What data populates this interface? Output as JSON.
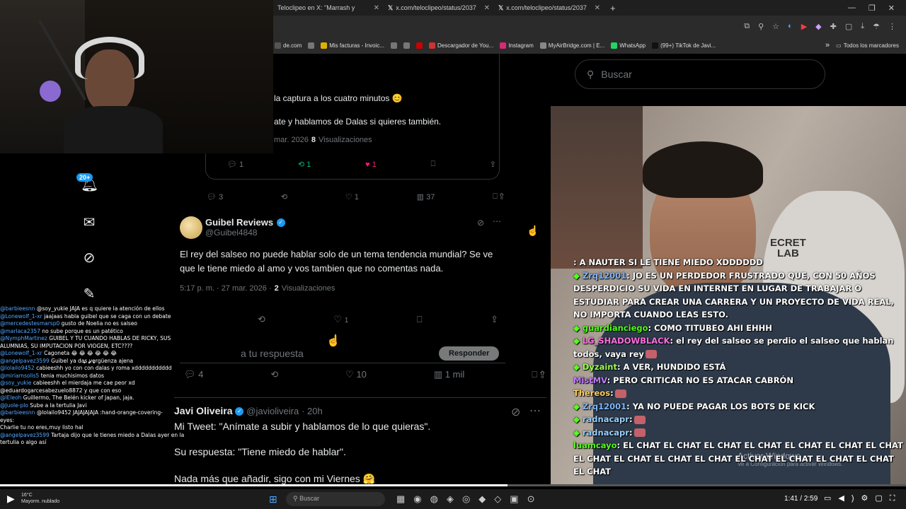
{
  "browser": {
    "tabs": [
      {
        "title": "Teloclipeo en X: \"Marrash y"
      },
      {
        "title": "x.com/teloclipeo/status/2037"
      },
      {
        "title": "x.com/teloclipeo/status/2037"
      }
    ],
    "new_tab": "+",
    "bookmarks": [
      {
        "label": "de.com",
        "color": "#555"
      },
      {
        "label": "",
        "color": "#777"
      },
      {
        "label": "Mis facturas - Invoic...",
        "color": "#e0b000"
      },
      {
        "label": "",
        "color": "#777"
      },
      {
        "label": "",
        "color": "#777"
      },
      {
        "label": "",
        "color": "#c00"
      },
      {
        "label": "Descargador de You...",
        "color": "#c33"
      },
      {
        "label": "Instagram",
        "color": "#d62976"
      },
      {
        "label": "MyAirBridge.com | E...",
        "color": "#888"
      },
      {
        "label": "WhatsApp",
        "color": "#25d366"
      },
      {
        "label": "(99+) TikTok de Javi...",
        "color": "#111"
      }
    ],
    "bookmarks_more": "»",
    "all_bookmarks": "Todos los marcadores"
  },
  "search": {
    "placeholder": "Buscar"
  },
  "nav_badge": "20+",
  "tweet_top": {
    "line1": "la captura a los cuatro minutos 😊",
    "line2": "ate y hablamos de Dalas si quieres también.",
    "meta_date": "mar. 2026",
    "meta_views_count": "8",
    "meta_views_label": "Visualizaciones",
    "reply_count": "1",
    "retweet_count": "1",
    "like_count": "1"
  },
  "tweet_parent_actions": {
    "reply": "3",
    "like": "1",
    "views": "37"
  },
  "tweet_guibel": {
    "name": "Guibel Reviews",
    "handle": "@Guibel4848",
    "text": "El rey del salseo no puede hablar solo de un tema tendencia mundial? Se ve que le tiene miedo al amo y vos tambien que no comentas nada.",
    "time": "5:17 p. m. · 27 mar. 2026 ·",
    "views_count": "2",
    "views_label": "Visualizaciones",
    "like_count": "1",
    "reply_placeholder": "a tu respuesta",
    "reply_button": "Responder"
  },
  "tweet_main_actions": {
    "reply": "4",
    "like": "10",
    "views": "1 mil"
  },
  "tweet_javi": {
    "name": "Javi Oliveira",
    "handle": "@javioliveira",
    "age": "· 20h",
    "line1": "Mi Tweet: \"Anímate a subir y hablamos de lo que quieras\".",
    "line2": "Su respuesta: \"Tiene miedo de hablar\".",
    "line3": "Nada más que añadir, sigo con mi Viernes 🤗"
  },
  "chat": [
    {
      "user": "",
      "color": "#ff4d4d",
      "text": ": A NAUTER SI LE TIENE MIEDO XDDDDDD",
      "diamond": false
    },
    {
      "user": "Zrq12001",
      "color": "#7fb8ff",
      "text": ": JO ES UN PERDEDOR FRUSTRADO QUE, CON 50 AÑOS DESPERDICIO SU VIDA EN INTERNET EN LUGAR DE TRABAJAR O ESTUDIAR PARA CREAR UNA CARRERA Y UN PROYECTO DE VIDA REAL, NO IMPORTA CUANDO LEAS ESTO.",
      "diamond": true
    },
    {
      "user": "guardianciego",
      "color": "#53fc18",
      "text": ": COMO TITUBEO AHI EHHH",
      "diamond": true
    },
    {
      "user": "LG_SHADOWBLACK",
      "color": "#ff6fe0",
      "text": ": el rey del salseo se perdio el salseo que hablan todos, vaya rey",
      "diamond": true,
      "emotes_end": 1
    },
    {
      "user": "Dyzaint",
      "color": "#9aff4d",
      "text": ": A VER, HUNDIDO ESTÁ",
      "diamond": true
    },
    {
      "user": "MistMV",
      "color": "#c27bff",
      "text": ": PERO CRITICAR NO ES ATACAR CABRÓN",
      "diamond": false
    },
    {
      "user": "Thereos",
      "color": "#ffcf5a",
      "text": ":",
      "diamond": false,
      "emotes_end": 1
    },
    {
      "user": "Zrq12001",
      "color": "#7fb8ff",
      "text": ": YA NO PUEDE PAGAR LOS BOTS DE KICK",
      "diamond": true
    },
    {
      "user": "radnacapr",
      "color": "#9ad0ff",
      "text": ":",
      "diamond": true,
      "emotes_end": 1
    },
    {
      "user": "radnacapr",
      "color": "#9ad0ff",
      "text": ":",
      "diamond": true,
      "emotes_end": 1
    },
    {
      "user": "luamcayo",
      "color": "#53fc18",
      "text": ": EL CHAT EL CHAT EL CHAT EL CHAT EL CHAT EL CHAT EL CHAT EL CHAT EL CHAT EL CHAT EL CHAT EL CHAT EL CHAT EL CHAT EL CHAT EL CHAT",
      "diamond": false
    }
  ],
  "minichat": [
    {
      "user": "@barbieesnn",
      "text": "@soy_yukie JAJA es q quiere la atención de ellos"
    },
    {
      "user": "@Lonewolf_1-xr",
      "text": "jaajaas habla guibel que se caga con un debate"
    },
    {
      "user": "@mercedestesmarsp0",
      "text": "gusto de Noelia no es salseo"
    },
    {
      "user": "@marlaca2357",
      "text": "no sube porque es un patético"
    },
    {
      "user": "@NymphMartinez",
      "text": "GUIBEL Y TU CUANDO HABLAS DE RICKY, SUS"
    },
    {
      "user": "",
      "text": "ALUMNIAS, SU IMPUTACION POR VIOGEN, ETC????"
    },
    {
      "user": "@Lonewolf_1-xr",
      "text": "Cagoneta 😂 😂 😂 😂 😂 😂"
    },
    {
      "user": "@angelpavez3599",
      "text": "Guibel ya das vergüenza ajena"
    },
    {
      "user": "@lolailo9452",
      "text": "cabieeshh yo con con dalas y roma xddddddddddd"
    },
    {
      "user": "@miriamsolis5",
      "text": "tenia muchisimos datos"
    },
    {
      "user": "@soy_yukie",
      "text": "cabieeshh el mierdaja me cae peor xd"
    },
    {
      "user": "",
      "text": "@eduardogarcesabezuelo8872 y que con eso"
    },
    {
      "user": "@lEleoh",
      "text": "Guillermo, The Belén kicker of Japan, jaja."
    },
    {
      "user": "@Juole-plo",
      "text": "Sube a la tertulia Javi"
    },
    {
      "user": "@barbieesnn",
      "text": "@lolailo9452 JAJAJAJAJA :hand-orange-covering-"
    },
    {
      "user": "",
      "text": "eyes:"
    },
    {
      "user": "",
      "text": "Charlie tu no eres,muy listo hal"
    },
    {
      "user": "@angelpavez3599",
      "text": "Tartaja dijo que le tienes miedo a Dalas ayer en la"
    },
    {
      "user": "",
      "text": "tertulia o algo así"
    }
  ],
  "video": {
    "brand_line1": "ECRET",
    "brand_line2": "LAB",
    "time": "1:41 / 2:59",
    "watermark1": "Activar Windows",
    "watermark2": "Ve a Configuración para activar Windows."
  },
  "taskbar": {
    "search_placeholder": "Buscar",
    "weather_temp": "16°C",
    "weather_desc": "Mayorm. nublado"
  }
}
